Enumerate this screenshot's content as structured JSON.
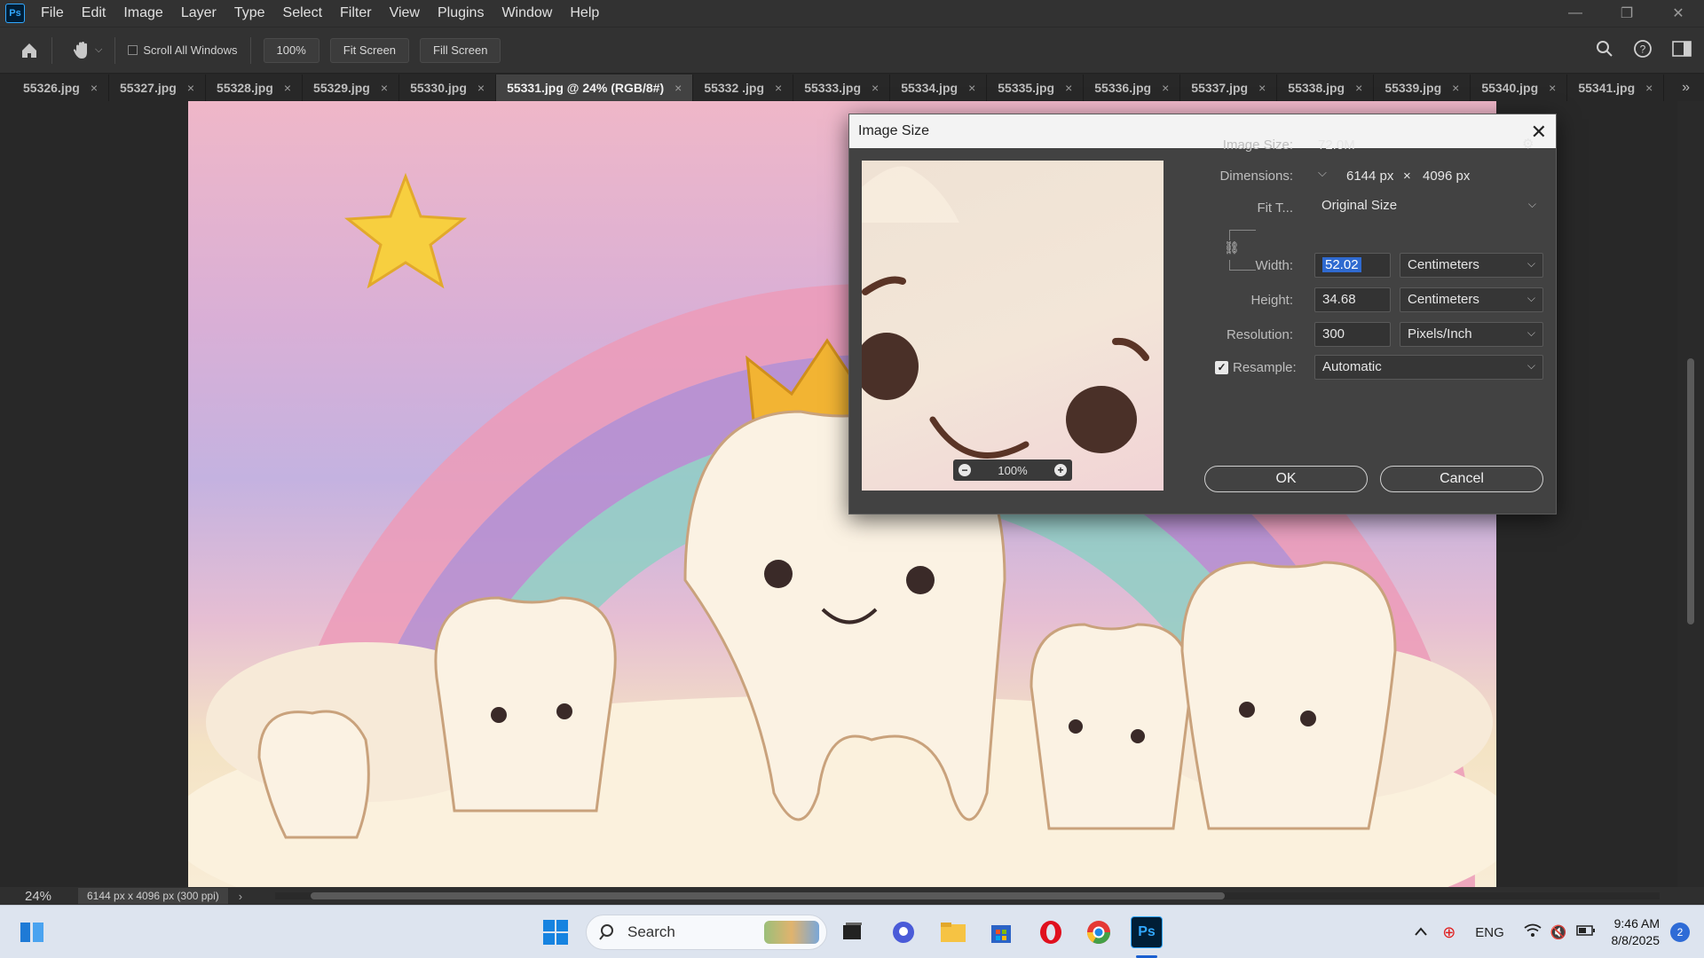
{
  "app": {
    "logo": "Ps"
  },
  "menu": [
    "File",
    "Edit",
    "Image",
    "Layer",
    "Type",
    "Select",
    "Filter",
    "View",
    "Plugins",
    "Window",
    "Help"
  ],
  "window_controls": {
    "minimize": "—",
    "restore": "❐",
    "close": "✕"
  },
  "options_bar": {
    "home_icon": "home-icon",
    "hand_icon": "hand-tool-icon",
    "scroll_all_windows": "Scroll All Windows",
    "zoom_value": "100%",
    "fit_screen": "Fit Screen",
    "fill_screen": "Fill Screen"
  },
  "tabs": [
    {
      "label": "55326.jpg",
      "active": false
    },
    {
      "label": "55327.jpg",
      "active": false
    },
    {
      "label": "55328.jpg",
      "active": false
    },
    {
      "label": "55329.jpg",
      "active": false
    },
    {
      "label": "55330.jpg",
      "active": false
    },
    {
      "label": "55331.jpg @ 24% (RGB/8#)",
      "active": true
    },
    {
      "label": "55332 .jpg",
      "active": false
    },
    {
      "label": "55333.jpg",
      "active": false
    },
    {
      "label": "55334.jpg",
      "active": false
    },
    {
      "label": "55335.jpg",
      "active": false
    },
    {
      "label": "55336.jpg",
      "active": false
    },
    {
      "label": "55337.jpg",
      "active": false
    },
    {
      "label": "55338.jpg",
      "active": false
    },
    {
      "label": "55339.jpg",
      "active": false
    },
    {
      "label": "55340.jpg",
      "active": false
    },
    {
      "label": "55341.jpg",
      "active": false
    }
  ],
  "tab_close": "×",
  "tab_more": "»",
  "status": {
    "zoom": "24%",
    "doc_info": "6144 px x 4096 px (300 ppi)",
    "arrow": "›"
  },
  "dialog": {
    "title": "Image Size",
    "close": "✕",
    "image_size_label": "Image Size:",
    "image_size_value": "72.0M",
    "dimensions_label": "Dimensions:",
    "dim_width": "6144 px",
    "dim_times": "×",
    "dim_height": "4096 px",
    "fit_label": "Fit T...",
    "fit_value": "Original Size",
    "width_label": "Width:",
    "width_value": "52.02",
    "width_unit": "Centimeters",
    "height_label": "Height:",
    "height_value": "34.68",
    "height_unit": "Centimeters",
    "resolution_label": "Resolution:",
    "resolution_value": "300",
    "resolution_unit": "Pixels/Inch",
    "resample_label": "Resample:",
    "resample_checked": true,
    "resample_value": "Automatic",
    "preview_zoom": "100%",
    "ok": "OK",
    "cancel": "Cancel"
  },
  "taskbar": {
    "search_placeholder": "Search",
    "lang": "ENG",
    "time": "9:46 AM",
    "date": "8/8/2025",
    "notifications": "2"
  }
}
